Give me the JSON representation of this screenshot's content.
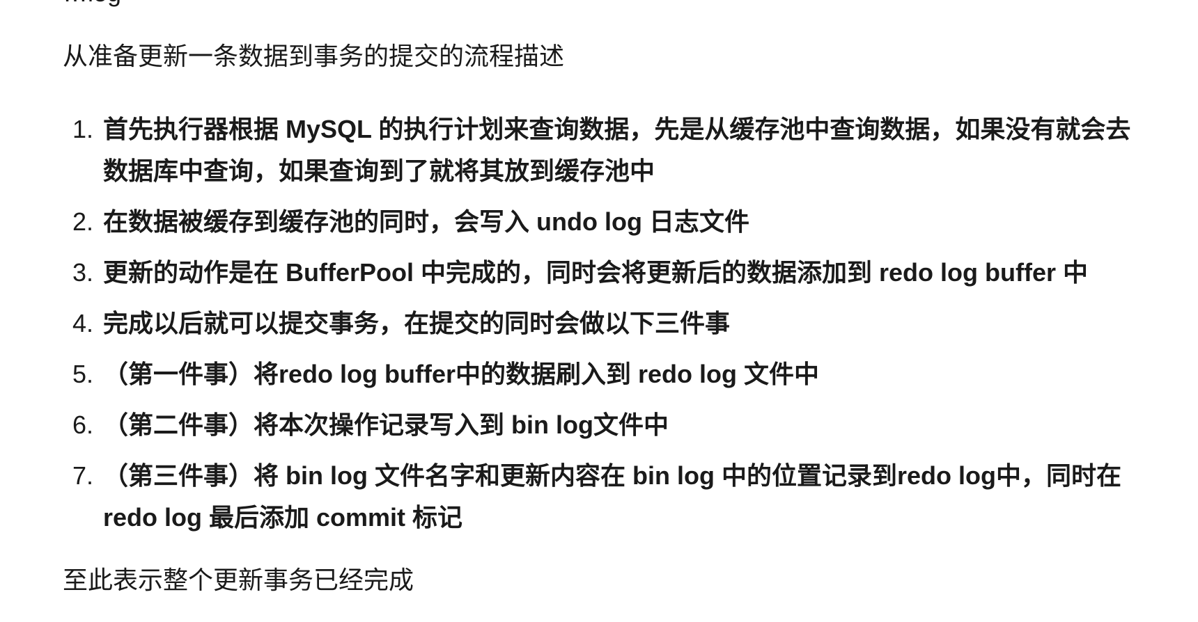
{
  "top_fragment": "…log",
  "intro": "从准备更新一条数据到事务的提交的流程描述",
  "steps": [
    {
      "num": "1.",
      "text": "首先执行器根据 MySQL 的执行计划来查询数据，先是从缓存池中查询数据，如果没有就会去数据库中查询，如果查询到了就将其放到缓存池中"
    },
    {
      "num": "2.",
      "text": "在数据被缓存到缓存池的同时，会写入 undo log 日志文件"
    },
    {
      "num": "3.",
      "text": "更新的动作是在 BufferPool 中完成的，同时会将更新后的数据添加到 redo log buffer 中"
    },
    {
      "num": "4.",
      "text": "完成以后就可以提交事务，在提交的同时会做以下三件事"
    },
    {
      "num": "5.",
      "text": "（第一件事）将redo log buffer中的数据刷入到 redo log 文件中"
    },
    {
      "num": "6.",
      "text": "（第二件事）将本次操作记录写入到 bin log文件中"
    },
    {
      "num": "7.",
      "text": "（第三件事）将 bin log 文件名字和更新内容在 bin log 中的位置记录到redo log中，同时在 redo log 最后添加 commit 标记"
    }
  ],
  "outro": "至此表示整个更新事务已经完成"
}
